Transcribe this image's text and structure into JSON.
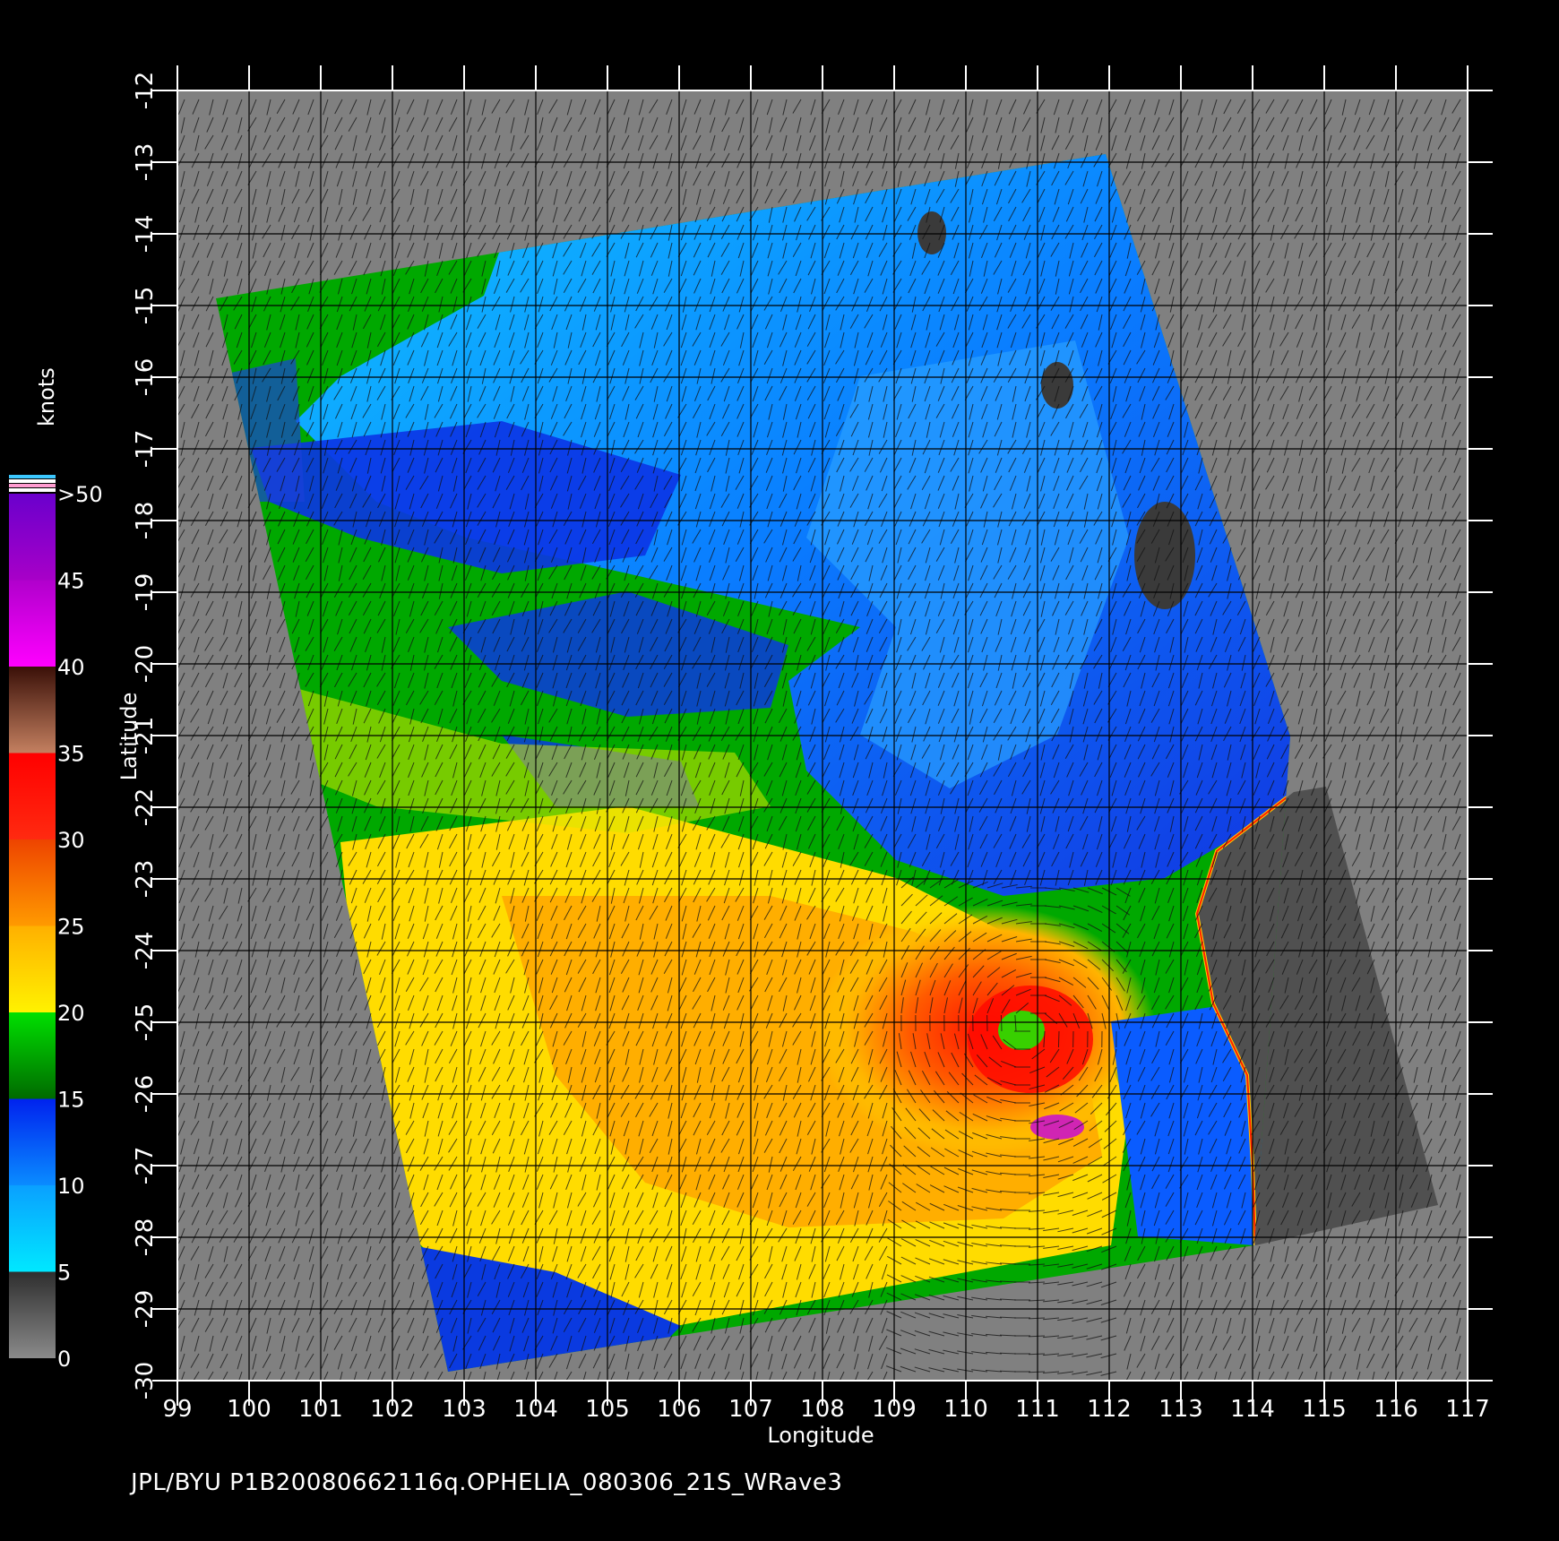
{
  "map": {
    "x_label": "Longitude",
    "y_label": "Latitude",
    "lon_ticks": [
      "99",
      "100",
      "101",
      "102",
      "103",
      "104",
      "105",
      "106",
      "107",
      "108",
      "109",
      "110",
      "111",
      "112",
      "113",
      "114",
      "115",
      "116",
      "117"
    ],
    "lat_ticks": [
      "-12",
      "-13",
      "-14",
      "-15",
      "-16",
      "-17",
      "-18",
      "-19",
      "-20",
      "-21",
      "-22",
      "-23",
      "-24",
      "-25",
      "-26",
      "-27",
      "-28",
      "-29",
      "-30"
    ],
    "lon_range": [
      99,
      117
    ],
    "lat_range": [
      -30,
      -12
    ],
    "colors": {
      "background": "#000000",
      "no_data": "#808080",
      "land": "#505050",
      "grid": "#000000"
    }
  },
  "colorbar": {
    "unit_label": "knots",
    "tick_labels": [
      ">50",
      "45",
      "40",
      "35",
      "30",
      "25",
      "20",
      "15",
      "10",
      "5",
      "0"
    ],
    "stops": [
      {
        "from": 0,
        "to": 5,
        "color_low": "#8a8a8a",
        "color_high": "#2e2e2e"
      },
      {
        "from": 5,
        "to": 10,
        "color_low": "#00e8ff",
        "color_high": "#0aa0ff"
      },
      {
        "from": 10,
        "to": 15,
        "color_low": "#0a8cff",
        "color_high": "#0022ee"
      },
      {
        "from": 15,
        "to": 20,
        "color_low": "#006a00",
        "color_high": "#00e000"
      },
      {
        "from": 20,
        "to": 25,
        "color_low": "#fff200",
        "color_high": "#ffb000"
      },
      {
        "from": 25,
        "to": 30,
        "color_low": "#ff9a00",
        "color_high": "#ee4400"
      },
      {
        "from": 30,
        "to": 35,
        "color_low": "#ff2a10",
        "color_high": "#ff0000"
      },
      {
        "from": 35,
        "to": 40,
        "color_low": "#c48060",
        "color_high": "#3a1008"
      },
      {
        "from": 40,
        "to": 45,
        "color_low": "#ff00ff",
        "color_high": "#b000cc"
      },
      {
        "from": 45,
        "to": 50,
        "color_low": "#a800c8",
        "color_high": "#6a00cc"
      }
    ]
  },
  "footer": {
    "text": "JPL/BYU  P1B20080662116q.OPHELIA_080306_21S_WRave3"
  }
}
